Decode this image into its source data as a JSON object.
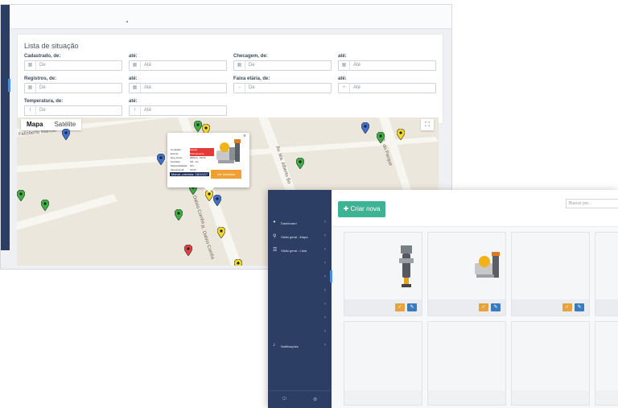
{
  "back_window": {
    "panel_title": "Lista de situação",
    "filters": [
      {
        "label": "Cadastrado, de:",
        "from_placeholder": "De",
        "to_label": "até:",
        "to_placeholder": "Até",
        "icon": "calendar-icon"
      },
      {
        "label": "Checagem, de:",
        "from_placeholder": "De",
        "to_label": "até:",
        "to_placeholder": "Até",
        "icon": "calendar-icon"
      },
      {
        "label": "Registros, de:",
        "from_placeholder": "De",
        "to_label": "até:",
        "to_placeholder": "Até",
        "icon": "calendar-icon"
      },
      {
        "label": "Faixa etária, de:",
        "from_placeholder": "De",
        "to_label": "até:",
        "to_placeholder": "Até",
        "icon": "minus-plus-icon"
      },
      {
        "label": "Temperatura, de:",
        "from_placeholder": "De",
        "to_label": "até:",
        "to_placeholder": "Até",
        "icon": "thermometer-icon"
      }
    ],
    "map": {
      "type_tabs": [
        "Mapa",
        "Satélite"
      ],
      "active_tab": "Mapa",
      "streets": [
        "Felisberto Manoel",
        "Av. Ma. Alberto Bo",
        "R. Dalvio Corrêa",
        "R. Dalvio Corrêa",
        "R. do Parque"
      ],
      "pin_colors": {
        "green": "#3cb043",
        "yellow": "#f2d82e",
        "blue": "#3f6fd0",
        "red": "#e04040"
      },
      "info_window": {
        "rows": [
          {
            "k": "Condição:",
            "v": "Estado",
            "alert": true
          },
          {
            "k": "Evento:",
            "v": "Subsequente",
            "alert": true
          },
          {
            "k": "Reg. Hora:",
            "v": "28/Sep - 09:32"
          },
          {
            "k": "Fechado:",
            "v": "Off - On"
          },
          {
            "k": "Disponibilidade:",
            "v": "ON"
          },
          {
            "k": "Operacional:",
            "v": "19:33"
          }
        ],
        "footer": "Manut. prevista: 18/10/17",
        "button": "Ver detalhes"
      }
    }
  },
  "front_window": {
    "create_button": "Criar nova",
    "search_placeholder": "Buscar por...",
    "nav": [
      {
        "label": "Dashboard",
        "icon": "palette-icon"
      },
      {
        "label": "Visão geral - Mapa",
        "icon": "map-pin-icon"
      },
      {
        "label": "Visão geral - Lista",
        "icon": "list-icon"
      },
      {
        "label": "",
        "icon": ""
      },
      {
        "label": "",
        "icon": ""
      },
      {
        "label": "",
        "icon": ""
      },
      {
        "label": "",
        "icon": ""
      },
      {
        "label": "",
        "icon": ""
      },
      {
        "label": "",
        "icon": ""
      },
      {
        "label": "Notificações",
        "icon": "bell-icon"
      }
    ],
    "accent_color": "#3cb394",
    "sidebar_color": "#2c3e63"
  }
}
